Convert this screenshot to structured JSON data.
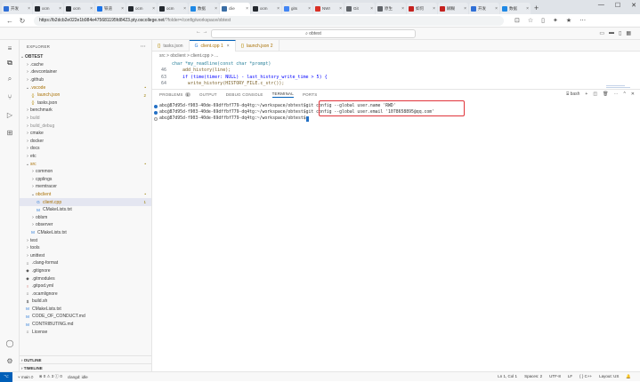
{
  "browser": {
    "tabs": [
      {
        "label": "开发",
        "color": "#2f6fd6"
      },
      {
        "label": "ocm",
        "color": "#24292f"
      },
      {
        "label": "ocm",
        "color": "#24292f"
      },
      {
        "label": "铁道",
        "color": "#1a73e8"
      },
      {
        "label": "ocm",
        "color": "#24292f"
      },
      {
        "label": "ocm",
        "color": "#24292f"
      },
      {
        "label": "数据",
        "color": "#1e88e5"
      },
      {
        "label": "clie",
        "color": "#3a6ea5",
        "active": true
      },
      {
        "label": "ocm",
        "color": "#24292f"
      },
      {
        "label": "gits",
        "color": "#4285f4"
      },
      {
        "label": "NWI",
        "color": "#d93025"
      },
      {
        "label": "Git",
        "color": "#5f6368"
      },
      {
        "label": "原生",
        "color": "#5f6368"
      },
      {
        "label": "如何",
        "color": "#c5221f"
      },
      {
        "label": "糊糊",
        "color": "#c5221f"
      },
      {
        "label": "开发",
        "color": "#2f6fd6"
      },
      {
        "label": "数据",
        "color": "#1e88e5"
      }
    ],
    "new_tab": "+",
    "url_host": "https://b2dcb2e022e1b984e475681195fd8423.pty.oscollege.net",
    "url_path": "/?folder=/config/workspace/obtest"
  },
  "vscode": {
    "command_center": "obtest",
    "sidebar": {
      "title": "EXPLORER",
      "root": "OBTEST",
      "items": [
        {
          "label": ".cache",
          "indent": 1,
          "type": "folder"
        },
        {
          "label": ".devcontainer",
          "indent": 1,
          "type": "folder"
        },
        {
          "label": ".github",
          "indent": 1,
          "type": "folder"
        },
        {
          "label": ".vscode",
          "indent": 1,
          "type": "folder-open",
          "badge": "•",
          "orange": true
        },
        {
          "label": "launch.json",
          "indent": 2,
          "type": "json",
          "badge": "2",
          "orange": true
        },
        {
          "label": "tasks.json",
          "indent": 2,
          "type": "json"
        },
        {
          "label": "benchmark",
          "indent": 1,
          "type": "folder"
        },
        {
          "label": "build",
          "indent": 1,
          "type": "folder",
          "dim": true
        },
        {
          "label": "build_debug",
          "indent": 1,
          "type": "folder",
          "dim": true
        },
        {
          "label": "cmake",
          "indent": 1,
          "type": "folder"
        },
        {
          "label": "docker",
          "indent": 1,
          "type": "folder"
        },
        {
          "label": "docs",
          "indent": 1,
          "type": "folder"
        },
        {
          "label": "etc",
          "indent": 1,
          "type": "folder"
        },
        {
          "label": "src",
          "indent": 1,
          "type": "folder-open",
          "badge": "•",
          "orange": true
        },
        {
          "label": "common",
          "indent": 2,
          "type": "folder"
        },
        {
          "label": "cpplings",
          "indent": 2,
          "type": "folder"
        },
        {
          "label": "memtracer",
          "indent": 2,
          "type": "folder"
        },
        {
          "label": "obclient",
          "indent": 2,
          "type": "folder-open",
          "badge": "•",
          "orange": true
        },
        {
          "label": "client.cpp",
          "indent": 3,
          "type": "cpp",
          "badge": "1",
          "orange": true,
          "selected": true
        },
        {
          "label": "CMakeLists.txt",
          "indent": 3,
          "type": "cmake"
        },
        {
          "label": "oblsm",
          "indent": 2,
          "type": "folder"
        },
        {
          "label": "observer",
          "indent": 2,
          "type": "folder"
        },
        {
          "label": "CMakeLists.txt",
          "indent": 2,
          "type": "cmake"
        },
        {
          "label": "test",
          "indent": 1,
          "type": "folder"
        },
        {
          "label": "tools",
          "indent": 1,
          "type": "folder"
        },
        {
          "label": "unittest",
          "indent": 1,
          "type": "folder"
        },
        {
          "label": ".clang-format",
          "indent": 1,
          "type": "file"
        },
        {
          "label": ".gitignore",
          "indent": 1,
          "type": "git"
        },
        {
          "label": ".gitmodules",
          "indent": 1,
          "type": "git"
        },
        {
          "label": ".gitpod.yml",
          "indent": 1,
          "type": "yml"
        },
        {
          "label": ".ocamlignore",
          "indent": 1,
          "type": "file"
        },
        {
          "label": "build.sh",
          "indent": 1,
          "type": "sh"
        },
        {
          "label": "CMakeLists.txt",
          "indent": 1,
          "type": "cmake"
        },
        {
          "label": "CODE_OF_CONDUCT.md",
          "indent": 1,
          "type": "md"
        },
        {
          "label": "CONTRIBUTING.md",
          "indent": 1,
          "type": "md"
        },
        {
          "label": "License",
          "indent": 1,
          "type": "file"
        }
      ],
      "outline": "OUTLINE",
      "timeline": "TIMELINE"
    },
    "editor": {
      "tabs": [
        {
          "label": "tasks.json",
          "icon": "{}"
        },
        {
          "label": "client.cpp 1",
          "icon": "G",
          "active": true
        },
        {
          "label": "launch.json 2",
          "icon": "{}"
        }
      ],
      "breadcrumb": "src > obclient > client.cpp > ...",
      "code": {
        "line0": "char *my_readline(const char *prompt)",
        "lines": [
          {
            "n": "46",
            "text": "    add_history(line);"
          },
          {
            "n": "63",
            "text": "    if (time(timer: NULL) - last_history_write_time > 5) {"
          },
          {
            "n": "64",
            "text": "      write_history(HISTORY_FILE.c_str());"
          }
        ]
      }
    },
    "panel": {
      "tabs": [
        "PROBLEMS",
        "OUTPUT",
        "DEBUG CONSOLE",
        "TERMINAL",
        "PORTS"
      ],
      "problems_count": "1",
      "terminal_name": "bash",
      "prompt": "abc@87d95d-f903-40de-69dffbf779-dq4tg:~/workspace/obtest$",
      "commands": [
        "git config --global user.name 'RWD'",
        "git config --global user.email '1078658895@qq.com'",
        ""
      ]
    },
    "status": {
      "branch": "main",
      "sync": "⟳",
      "errors": "0",
      "warnings": "3",
      "info": "0",
      "clangd": "clangd: idle",
      "position": "Ln 1, Col 1",
      "spaces": "Spaces: 2",
      "encoding": "UTF-8",
      "eol": "LF",
      "language": "C++",
      "layout": "Layout: US"
    }
  }
}
